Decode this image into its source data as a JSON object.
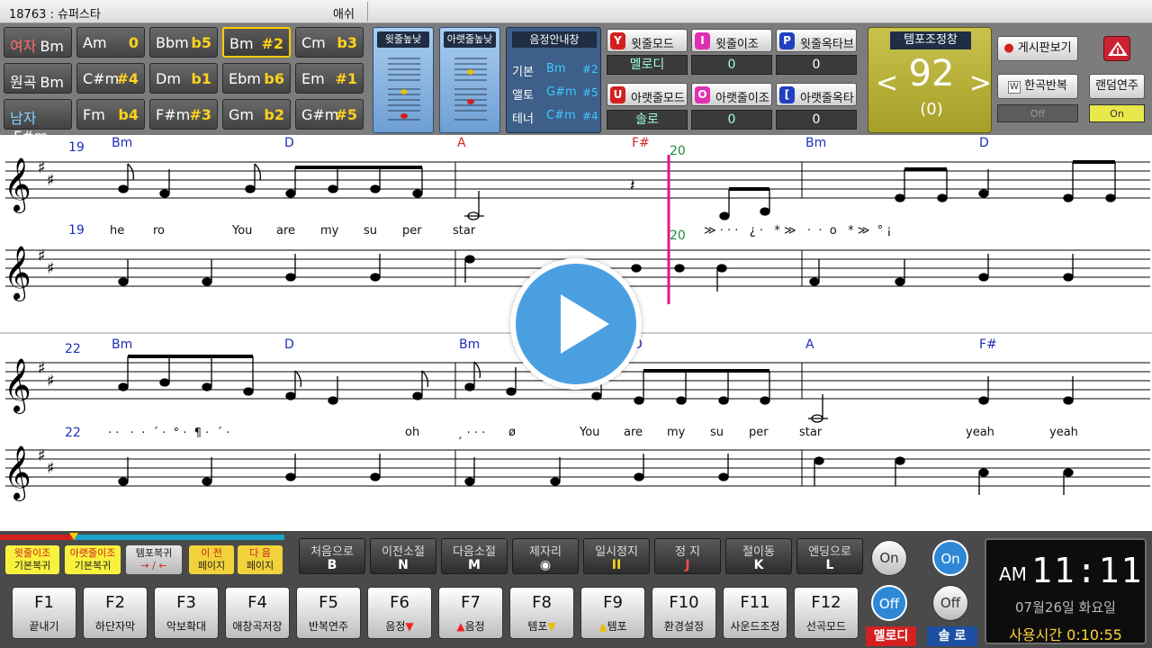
{
  "titlebar": {
    "song": "18763 : 슈퍼스타",
    "artist": "애쉬"
  },
  "key_table": [
    {
      "label": "여자",
      "key": "Bm",
      "adj": "",
      "label_class": ""
    },
    {
      "label": "",
      "key": "Am",
      "adj": "0",
      "label_class": ""
    },
    {
      "label": "",
      "key": "Bbm",
      "adj": "b5",
      "label_class": ""
    },
    {
      "label": "",
      "key": "Bm",
      "adj": "#2",
      "label_class": "",
      "selected": true
    },
    {
      "label": "",
      "key": "Cm",
      "adj": "b3",
      "label_class": ""
    },
    {
      "label": "원곡",
      "key": "Bm",
      "adj": "",
      "label_class": "o"
    },
    {
      "label": "",
      "key": "C#m",
      "adj": "#4",
      "label_class": ""
    },
    {
      "label": "",
      "key": "Dm",
      "adj": "b1",
      "label_class": ""
    },
    {
      "label": "",
      "key": "Ebm",
      "adj": "b6",
      "label_class": ""
    },
    {
      "label": "",
      "key": "Em",
      "adj": "#1",
      "label_class": ""
    },
    {
      "label": "남자",
      "key": "F#m",
      "adj": "",
      "label_class": "m"
    },
    {
      "label": "",
      "key": "Fm",
      "adj": "b4",
      "label_class": ""
    },
    {
      "label": "",
      "key": "F#m",
      "adj": "#3",
      "label_class": ""
    },
    {
      "label": "",
      "key": "Gm",
      "adj": "b2",
      "label_class": ""
    },
    {
      "label": "",
      "key": "G#m",
      "adj": "#5",
      "label_class": ""
    }
  ],
  "staff_boxes": {
    "upper": "윗줄높낮",
    "lower": "아랫줄높낮"
  },
  "pitch_guide": {
    "title": "음정안내창",
    "rows": [
      {
        "name": "기본",
        "key": "Bm",
        "adj": "#2"
      },
      {
        "name": "앨토",
        "key": "G#m",
        "adj": "#5"
      },
      {
        "name": "테너",
        "key": "C#m",
        "adj": "#4"
      }
    ]
  },
  "modes": {
    "upper_mode": {
      "badge": "Y",
      "label": "윗줄모드",
      "value": "멜로디"
    },
    "upper_transpose": {
      "badge": "I",
      "label": "윗줄이조",
      "value": "0"
    },
    "upper_octave": {
      "badge": "P",
      "label": "윗줄옥타브",
      "value": "0"
    },
    "lower_mode": {
      "badge": "U",
      "label": "아랫줄모드",
      "value": "솔로"
    },
    "lower_transpose": {
      "badge": "O",
      "label": "아랫줄이조",
      "value": "0"
    },
    "lower_octave": {
      "badge": "[",
      "label": "아랫줄옥타브",
      "value": "0"
    }
  },
  "tempo": {
    "title": "템포조정창",
    "value": "92",
    "offset": "(0)",
    "left": "<",
    "right": ">"
  },
  "right_controls": {
    "board": "게시판보기",
    "repeat": "한곡반복",
    "repeat_badge": "W",
    "repeat_state": "Off",
    "random": "랜덤연주",
    "random_state": "On"
  },
  "score": {
    "system1_measures": [
      "19",
      "19"
    ],
    "system2_measures": [
      "22",
      "22"
    ],
    "cursor_labels": [
      "20",
      "20"
    ],
    "chords_row1": [
      "Bm",
      "D",
      "A",
      "F#",
      "Bm",
      "D"
    ],
    "chords_row2": [
      "Bm",
      "D",
      "Bm",
      "D",
      "A",
      "F#"
    ],
    "lyrics_row1": [
      "he",
      "ro",
      "You",
      "are",
      "my",
      "su",
      "per",
      "star"
    ],
    "lyrics_row1_next": "≫ · · ·   ¿ ·   * ≫   ·  ·  o   * ≫  ° ¡",
    "lyrics_row2_prefix": "· ·   ·  ·  ´ ·  ° ·  ¶ ·  ´ ·",
    "lyrics_row2": [
      "oh",
      "ø",
      "You",
      "are",
      "my",
      "su",
      "per",
      "star",
      "yeah",
      "yeah"
    ],
    "lyrics_row2_dot": "¸ · · ·"
  },
  "bottom": {
    "progress_fraction": 0.26,
    "small_buttons": [
      {
        "l1": "윗줄이조",
        "l2": "기본복귀"
      },
      {
        "l1": "아랫줄이조",
        "l2": "기본복귀"
      },
      {
        "l1": "템포복귀",
        "l2": "→ / ←"
      },
      {
        "l1": "이 전",
        "l2": "페이지"
      },
      {
        "l1": "다 음",
        "l2": "페이지"
      }
    ],
    "nav_buttons": [
      {
        "l1": "처음으로",
        "l2": "B"
      },
      {
        "l1": "이전소절",
        "l2": "N"
      },
      {
        "l1": "다음소절",
        "l2": "M"
      },
      {
        "l1": "제자리",
        "l2": "◉"
      },
      {
        "l1": "일시정지",
        "l2": "II"
      },
      {
        "l1": "정 지",
        "l2": "J"
      },
      {
        "l1": "절이동",
        "l2": "K"
      },
      {
        "l1": "엔딩으로",
        "l2": "L"
      }
    ],
    "fkeys": [
      {
        "k": "F1",
        "d": "끝내기"
      },
      {
        "k": "F2",
        "d": "하단자막"
      },
      {
        "k": "F3",
        "d": "악보확대"
      },
      {
        "k": "F4",
        "d": "애창곡저장"
      },
      {
        "k": "F5",
        "d": "반복연주"
      },
      {
        "k": "F6",
        "d": "음정",
        "suffix": "▼"
      },
      {
        "k": "F7",
        "d": "음정",
        "prefix": "▲"
      },
      {
        "k": "F8",
        "d": "템포",
        "suffix": "▼"
      },
      {
        "k": "F9",
        "d": "템포",
        "prefix": "▲"
      },
      {
        "k": "F10",
        "d": "환경설정"
      },
      {
        "k": "F11",
        "d": "사운드조정"
      },
      {
        "k": "F12",
        "d": "선곡모드"
      }
    ],
    "melody_toggle": {
      "on": "On",
      "off": "Off",
      "label": "멜로디"
    },
    "solo_toggle": {
      "on": "On",
      "off": "Off",
      "label": "솔 로"
    },
    "clock": {
      "ampm": "AM",
      "time": "11:11",
      "date": "07월26일 화요일",
      "usage": "사용시간 0:10:55"
    }
  }
}
